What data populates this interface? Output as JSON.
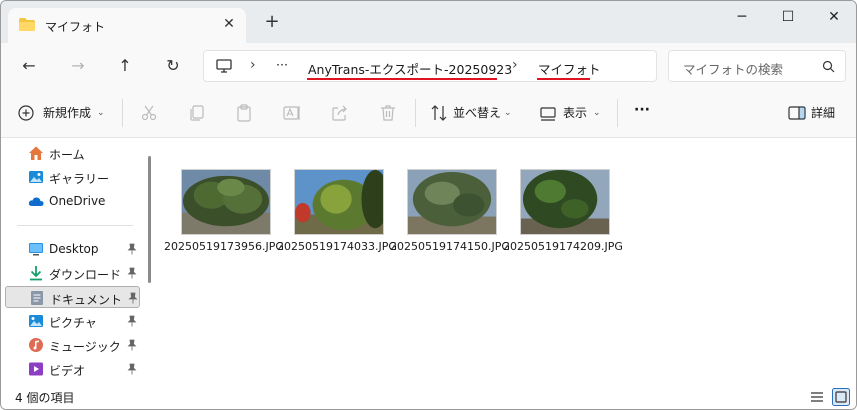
{
  "window": {
    "tab_title": "マイフォト",
    "new_tab": "+",
    "controls": {
      "minimize": "─",
      "maximize": "☐",
      "close": "✕"
    }
  },
  "nav": {
    "back": "←",
    "forward": "→",
    "up": "↑",
    "refresh": "↻",
    "overflow": "···",
    "breadcrumb": [
      "AnyTrans-エクスポート-20250923",
      "マイフォト"
    ],
    "separator": "›",
    "search_placeholder": "マイフォトの検索"
  },
  "toolbar": {
    "new_label": "新規作成",
    "sort_label": "並べ替え",
    "view_label": "表示",
    "more_label": "···",
    "details_label": "詳細"
  },
  "sidebar": {
    "items": [
      {
        "label": "ホーム",
        "icon": "home-icon",
        "pinned": false
      },
      {
        "label": "ギャラリー",
        "icon": "gallery-icon",
        "pinned": false
      },
      {
        "label": "OneDrive",
        "icon": "onedrive-icon",
        "pinned": false
      },
      {
        "label": "Desktop",
        "icon": "desktop-icon",
        "pinned": true
      },
      {
        "label": "ダウンロード",
        "icon": "download-icon",
        "pinned": true
      },
      {
        "label": "ドキュメント",
        "icon": "documents-icon",
        "pinned": true,
        "selected": true
      },
      {
        "label": "ピクチャ",
        "icon": "pictures-icon",
        "pinned": true
      },
      {
        "label": "ミュージック",
        "icon": "music-icon",
        "pinned": true
      },
      {
        "label": "ビデオ",
        "icon": "video-icon",
        "pinned": true
      }
    ]
  },
  "files": [
    {
      "name": "20250519173956.JPG"
    },
    {
      "name": "20250519174033.JPG"
    },
    {
      "name": "20250519174150.JPG"
    },
    {
      "name": "20250519174209.JPG"
    }
  ],
  "status": {
    "item_count": "4 個の項目"
  },
  "colors": {
    "accent": "#0067c0",
    "highlight_underline": "#e0141e",
    "folder": "#f4c542"
  }
}
